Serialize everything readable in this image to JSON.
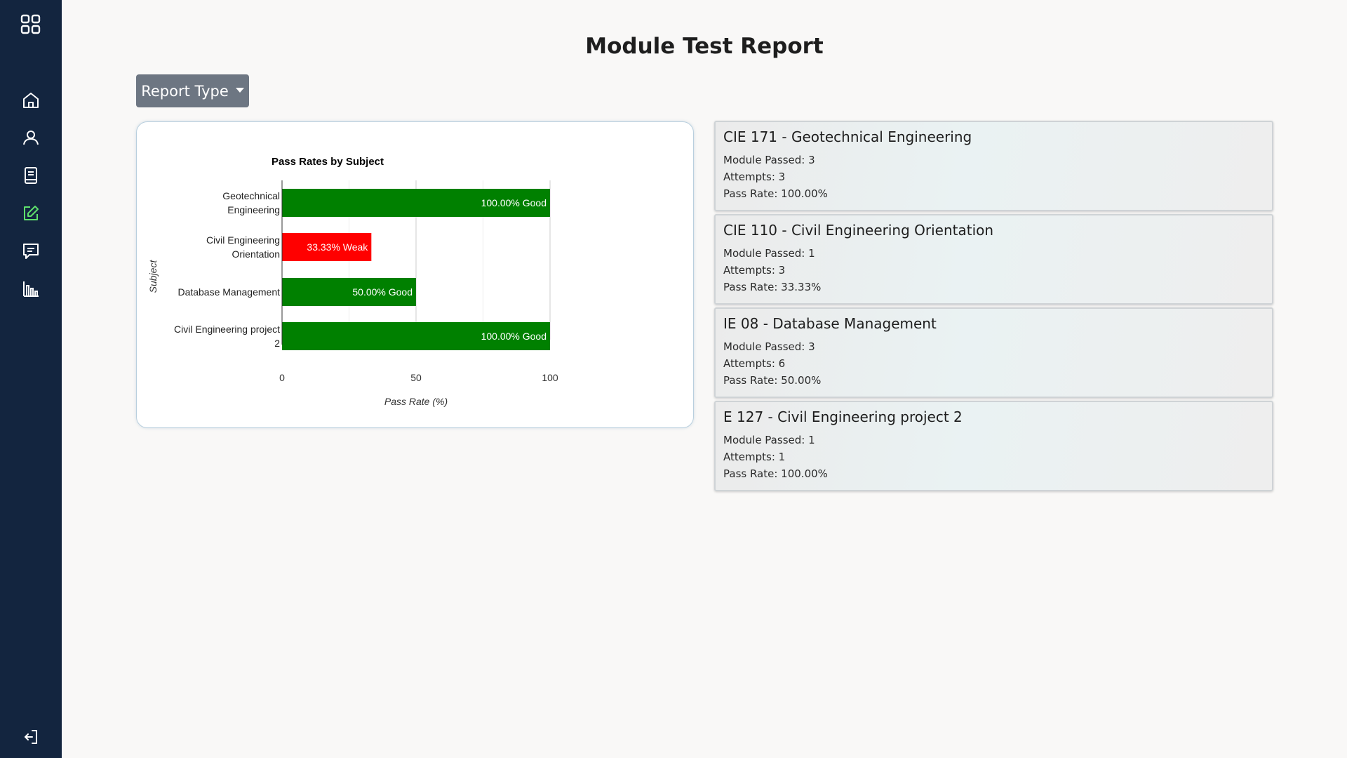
{
  "page_title": "Module Test Report",
  "report_button": {
    "label": "Report Type"
  },
  "sidebar": {
    "items": [
      {
        "icon": "grid-icon"
      },
      {
        "icon": "home-icon"
      },
      {
        "icon": "user-icon"
      },
      {
        "icon": "book-icon"
      },
      {
        "icon": "edit-icon",
        "active": true,
        "color": "#5ee06c"
      },
      {
        "icon": "chat-icon"
      },
      {
        "icon": "bar-chart-icon"
      },
      {
        "icon": "logout-icon"
      }
    ]
  },
  "chart_data": {
    "type": "bar",
    "orientation": "horizontal",
    "title": "Pass Rates by Subject",
    "xlabel": "Pass Rate (%)",
    "ylabel": "Subject",
    "xlim": [
      0,
      100
    ],
    "xticks": [
      0,
      50,
      100
    ],
    "grid": true,
    "categories": [
      [
        "Geotechnical",
        "Engineering"
      ],
      [
        "Civil Engineering",
        "Orientation"
      ],
      [
        "Database Management"
      ],
      [
        "Civil Engineering project",
        "2"
      ]
    ],
    "values": [
      100,
      33.33,
      50,
      100
    ],
    "data_labels": [
      "100.00% Good",
      "33.33% Weak",
      "50.00% Good",
      "100.00% Good"
    ],
    "colors": [
      "#008000",
      "#ff0000",
      "#008000",
      "#008000"
    ]
  },
  "modules": [
    {
      "title": "CIE 171 - Geotechnical Engineering",
      "passed": "Module Passed: 3",
      "attempts": "Attempts: 3",
      "rate": "Pass Rate: 100.00%"
    },
    {
      "title": "CIE 110 - Civil Engineering Orientation",
      "passed": "Module Passed: 1",
      "attempts": "Attempts: 3",
      "rate": "Pass Rate: 33.33%"
    },
    {
      "title": "IE 08 - Database Management",
      "passed": "Module Passed: 3",
      "attempts": "Attempts: 6",
      "rate": "Pass Rate: 50.00%"
    },
    {
      "title": "E 127 - Civil Engineering project 2",
      "passed": "Module Passed: 1",
      "attempts": "Attempts: 1",
      "rate": "Pass Rate: 100.00%"
    }
  ]
}
